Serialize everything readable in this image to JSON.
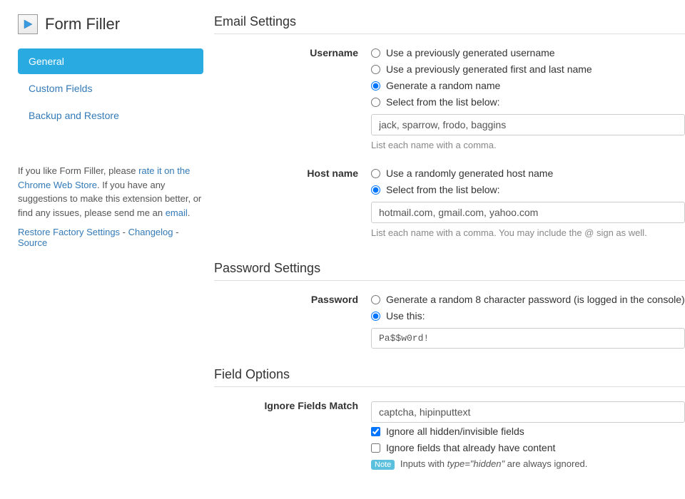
{
  "app": {
    "title": "Form Filler"
  },
  "nav": {
    "items": [
      {
        "label": "General",
        "active": true
      },
      {
        "label": "Custom Fields",
        "active": false
      },
      {
        "label": "Backup and Restore",
        "active": false
      }
    ]
  },
  "blurb": {
    "prefix": "If you like Form Filler, please ",
    "rate_link": "rate it on the Chrome Web Store",
    "middle": ". If you have any suggestions to make this extension better, or find any issues, please send me an ",
    "email_link": "email",
    "suffix": "."
  },
  "links": {
    "restore": "Restore Factory Settings",
    "changelog": "Changelog",
    "source": "Source",
    "sep": " - "
  },
  "sections": {
    "email": {
      "title": "Email Settings",
      "username": {
        "label": "Username",
        "opt_prev_user": "Use a previously generated username",
        "opt_prev_name": "Use a previously generated first and last name",
        "opt_random": "Generate a random name",
        "opt_list": "Select from the list below:",
        "list_value": "jack, sparrow, frodo, baggins",
        "help": "List each name with a comma."
      },
      "hostname": {
        "label": "Host name",
        "opt_random": "Use a randomly generated host name",
        "opt_list": "Select from the list below:",
        "list_value": "hotmail.com, gmail.com, yahoo.com",
        "help": "List each name with a comma. You may include the @ sign as well."
      }
    },
    "password": {
      "title": "Password Settings",
      "label": "Password",
      "opt_random": "Generate a random 8 character password (is logged in the console)",
      "opt_this": "Use this:",
      "value": "Pa$$w0rd!"
    },
    "fields": {
      "title": "Field Options",
      "ignore_label": "Ignore Fields Match",
      "ignore_value": "captcha, hipinputtext",
      "chk_hidden": "Ignore all hidden/invisible fields",
      "chk_content": "Ignore fields that already have content",
      "note_badge": "Note",
      "note_prefix": " Inputs with ",
      "note_em": "type=\"hidden\"",
      "note_suffix": " are always ignored."
    }
  }
}
